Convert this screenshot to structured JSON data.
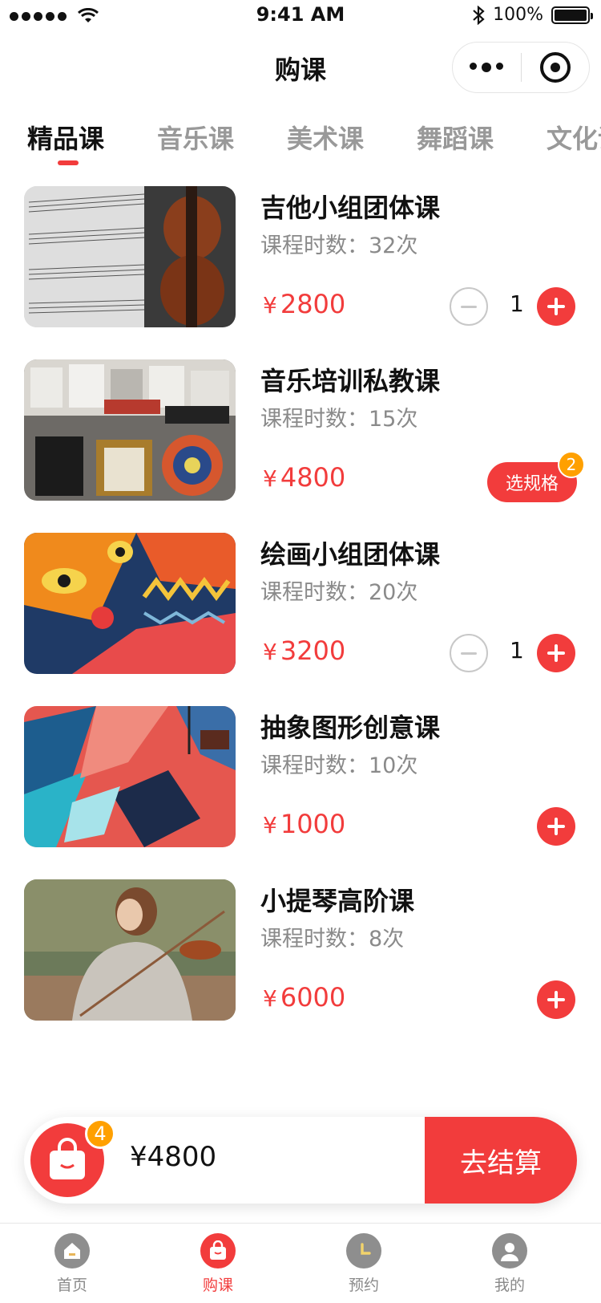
{
  "status_bar": {
    "time": "9:41 AM",
    "battery": "100%",
    "icons": [
      "signal-dots-icon",
      "wifi-icon",
      "bluetooth-icon",
      "battery-icon"
    ]
  },
  "nav": {
    "title": "购课",
    "capsule": [
      "more-icon",
      "close-icon"
    ]
  },
  "tabs": [
    {
      "label": "精品课",
      "active": true
    },
    {
      "label": "音乐课",
      "active": false
    },
    {
      "label": "美术课",
      "active": false
    },
    {
      "label": "舞蹈课",
      "active": false
    },
    {
      "label": "文化课",
      "active": false
    }
  ],
  "courses": [
    {
      "name": "吉他小组团体课",
      "meta": "课程时数：32次",
      "currency": "¥",
      "price": "2800",
      "qty": "1",
      "control": "stepper",
      "image": "violin-and-sheet-music"
    },
    {
      "name": "音乐培训私教课",
      "meta": "课程时数：15次",
      "currency": "¥",
      "price": "4800",
      "spec_label": "选规格",
      "spec_badge": "2",
      "control": "spec",
      "image": "record-store-albums"
    },
    {
      "name": "绘画小组团体课",
      "meta": "课程时数：20次",
      "currency": "¥",
      "price": "3200",
      "qty": "1",
      "control": "stepper",
      "image": "colorful-mural-painting"
    },
    {
      "name": "抽象图形创意课",
      "meta": "课程时数：10次",
      "currency": "¥",
      "price": "1000",
      "control": "add",
      "image": "abstract-geometric-art"
    },
    {
      "name": "小提琴高阶课",
      "meta": "课程时数：8次",
      "currency": "¥",
      "price": "6000",
      "control": "add",
      "image": "woman-playing-violin"
    }
  ],
  "cart": {
    "count": "4",
    "total": "¥4800",
    "checkout_label": "去结算"
  },
  "tabbar": [
    {
      "label": "首页",
      "icon": "home-icon",
      "active": false
    },
    {
      "label": "购课",
      "icon": "shopping-bag-icon",
      "active": true
    },
    {
      "label": "预约",
      "icon": "clock-icon",
      "active": false
    },
    {
      "label": "我的",
      "icon": "user-icon",
      "active": false
    }
  ],
  "colors": {
    "accent": "#f23c3c",
    "badge": "#ffa000",
    "muted": "#8a8a8a"
  }
}
